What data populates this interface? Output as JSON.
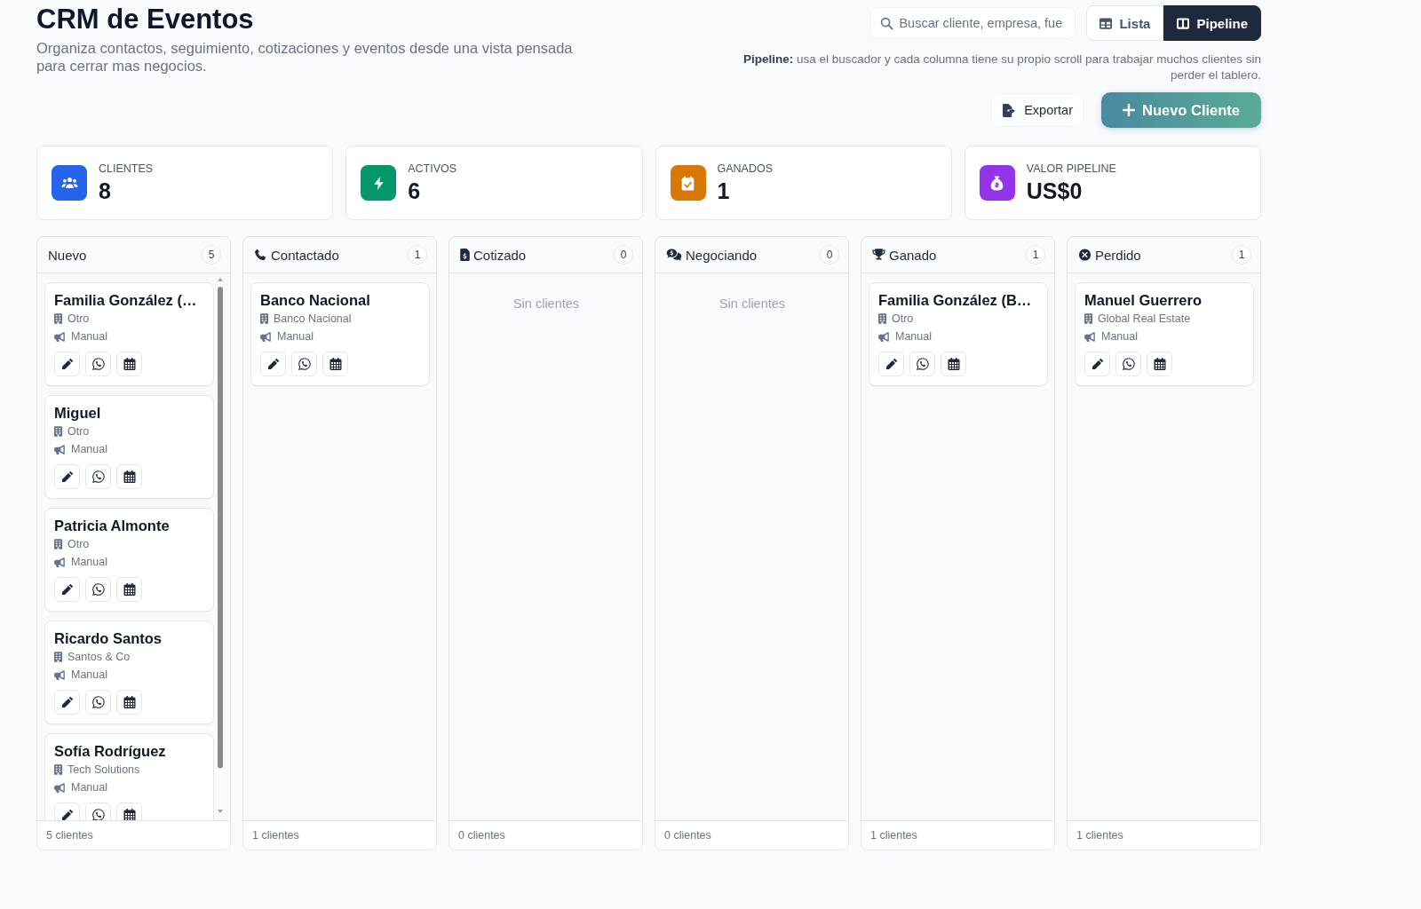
{
  "header": {
    "title": "CRM de Eventos",
    "subtitle": "Organiza contactos, seguimiento, cotizaciones y eventos desde una vista pensada para cerrar mas negocios."
  },
  "search": {
    "placeholder": "Buscar cliente, empresa, fue"
  },
  "view_tabs": [
    {
      "label": "Lista",
      "selected": false
    },
    {
      "label": "Pipeline",
      "selected": true
    }
  ],
  "help_text": "**Pipeline:** usa el buscador y cada columna tiene su propio scroll para trabajar muchos clientes sin perder el tablero.",
  "actions": [
    {
      "label": "Exportar",
      "kind": "secondary"
    },
    {
      "label": "Nuevo Cliente",
      "kind": "primary"
    }
  ],
  "stats": [
    {
      "label": "CLIENTES",
      "value": "8",
      "color": "#2563eb"
    },
    {
      "label": "ACTIVOS",
      "value": "6",
      "color": "#059669"
    },
    {
      "label": "GANADOS",
      "value": "1",
      "color": "#d97706"
    },
    {
      "label": "VALOR PIPELINE",
      "value": "US$0",
      "color": "#9333ea"
    }
  ],
  "pipeline": [
    {
      "title": "Nuevo",
      "count": "5",
      "clients": [
        {
          "name": "Familia González (…",
          "company": "Otro",
          "source": "Manual"
        },
        {
          "name": "Miguel",
          "company": "Otro",
          "source": "Manual"
        },
        {
          "name": "Patricia Almonte",
          "company": "Otro",
          "source": "Manual"
        },
        {
          "name": "Ricardo Santos",
          "company": "Santos & Co",
          "source": "Manual"
        },
        {
          "name": "Sofía Rodríguez",
          "company": "Tech Solutions",
          "source": "Manual"
        }
      ],
      "footer": "5 clientes"
    },
    {
      "title": "Contactado",
      "count": "1",
      "clients": [
        {
          "name": "Banco Nacional",
          "company": "Banco Nacional",
          "source": "Manual"
        }
      ],
      "footer": "1 clientes"
    },
    {
      "title": "Cotizado",
      "count": "0",
      "empty_text": "Sin clientes",
      "footer": "0 clientes"
    },
    {
      "title": "Negociando",
      "count": "0",
      "empty_text": "Sin clientes",
      "footer": "0 clientes"
    },
    {
      "title": "Ganado",
      "count": "1",
      "clients": [
        {
          "name": "Familia González (B…",
          "company": "Otro",
          "source": "Manual"
        }
      ],
      "footer": "1 clientes"
    },
    {
      "title": "Perdido",
      "count": "1",
      "clients": [
        {
          "name": "Manuel Guerrero",
          "company": "Global Real Estate",
          "source": "Manual"
        }
      ],
      "footer": "1 clientes"
    }
  ]
}
